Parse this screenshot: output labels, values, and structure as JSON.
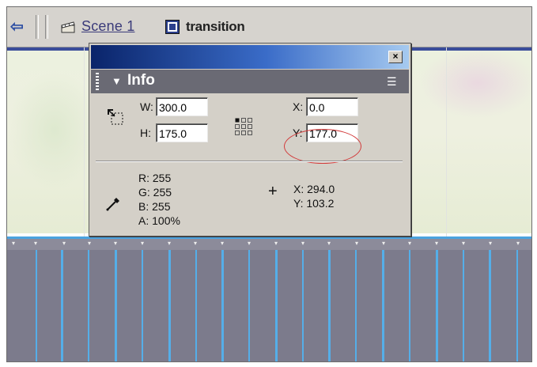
{
  "toolbar": {
    "back_icon": "left-arrow-icon",
    "scene_label": "Scene 1",
    "scene_icon": "clapperboard-icon",
    "symbol_label": "transition",
    "symbol_icon": "movie-clip-icon"
  },
  "info_panel": {
    "title": "Info",
    "close_label": "×",
    "menu_icon": "options-menu-icon",
    "dimensions": {
      "w_label": "W:",
      "w_value": "300.0",
      "h_label": "H:",
      "h_value": "175.0"
    },
    "position": {
      "x_label": "X:",
      "x_value": "0.0",
      "y_label": "Y:",
      "y_value": "177.0"
    },
    "color": {
      "r": "R: 255",
      "g": "G: 255",
      "b": "B: 255",
      "a": "A: 100%"
    },
    "cursor": {
      "x": "X: 294.0",
      "y": "Y: 103.2"
    }
  },
  "colors": {
    "panel_bg": "#d4d0c8",
    "title_bar": "#0a246a",
    "header_bar": "#6a6a74",
    "highlight_circle": "#d23a3a",
    "filmstrip_bg": "#7c7b8c",
    "filmstrip_stripe": "#55aee8"
  }
}
